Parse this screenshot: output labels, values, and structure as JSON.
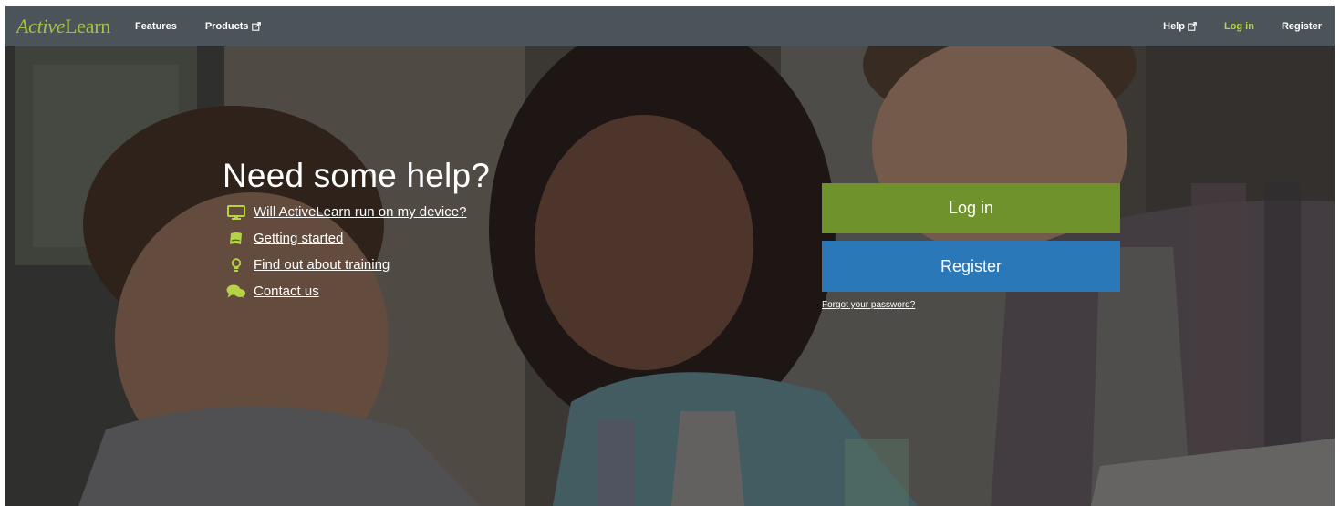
{
  "navbar": {
    "brand_part1": "Active",
    "brand_part2": "Learn",
    "features": "Features",
    "products": "Products",
    "help": "Help",
    "login": "Log in",
    "register": "Register"
  },
  "help": {
    "title": "Need some help?",
    "links": [
      {
        "label": "Will ActiveLearn run on my device?",
        "icon": "monitor-icon"
      },
      {
        "label": "Getting started",
        "icon": "book-icon"
      },
      {
        "label": "Find out about training",
        "icon": "lightbulb-icon"
      },
      {
        "label": "Contact us",
        "icon": "chat-bubbles-icon"
      }
    ]
  },
  "auth": {
    "login_label": "Log in",
    "register_label": "Register",
    "forgot_label": "Forgot your password?"
  },
  "colors": {
    "navbar_bg": "#4b5458",
    "brand_green": "#a5c34a",
    "login_green": "#70922d",
    "register_blue": "#2b78b8",
    "icon_green": "#b6d346"
  }
}
